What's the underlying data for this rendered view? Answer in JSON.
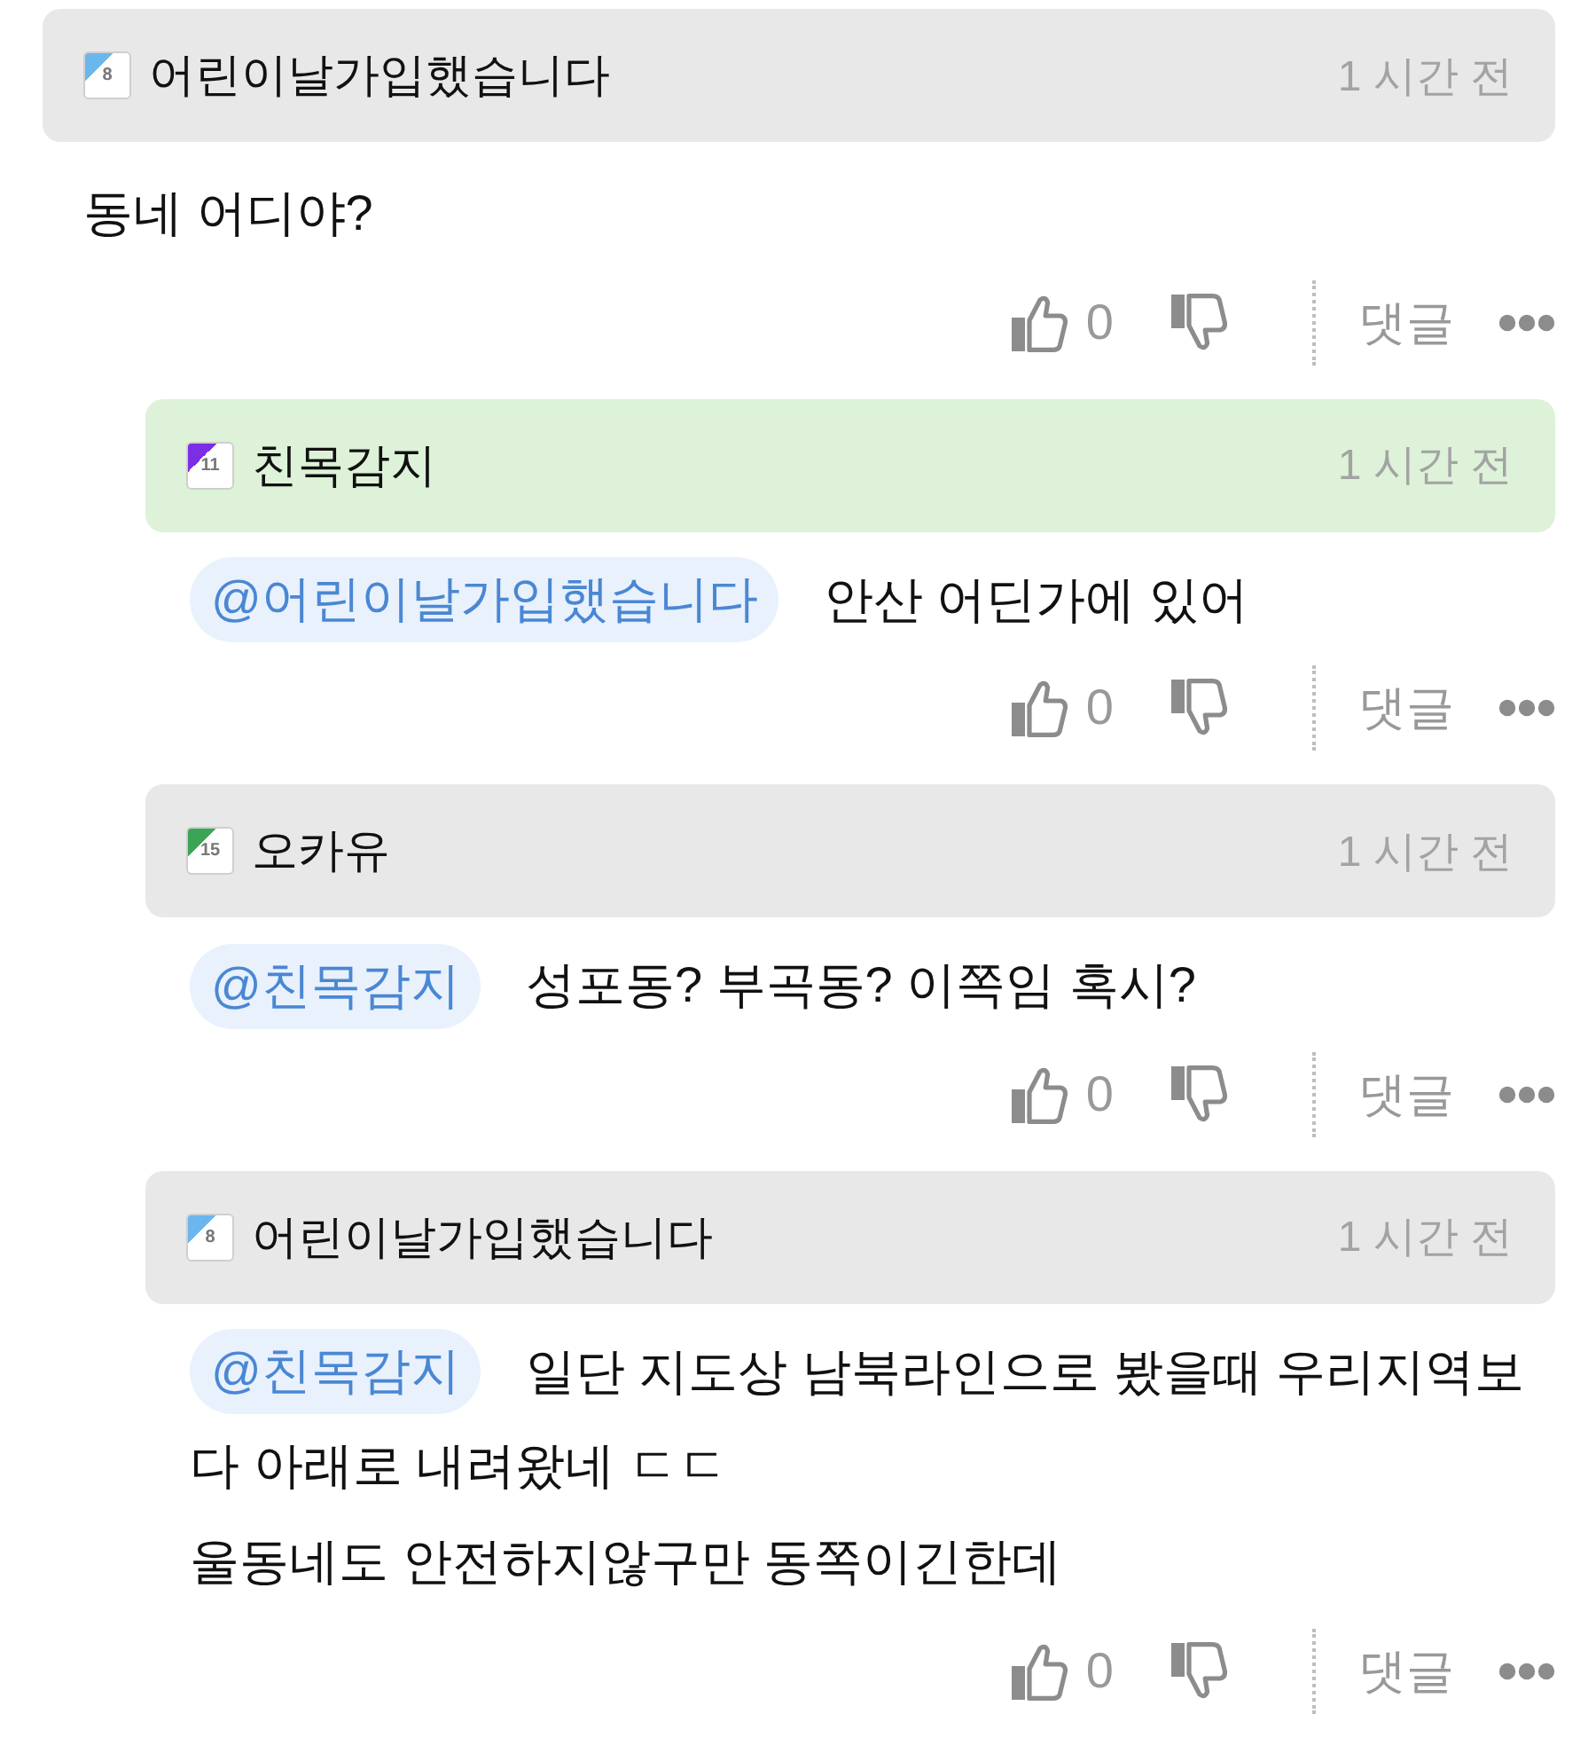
{
  "comments": [
    {
      "author": "어린이날가입했습니다",
      "badge": {
        "text": "8",
        "color": "#6cb6ee"
      },
      "highlighted": false,
      "time": "1 시간 전",
      "text": "동네 어디야?",
      "likes": "0",
      "reply_label": "댓글",
      "children": [
        {
          "author": "친목감지",
          "badge": {
            "text": "11",
            "color": "#7a2ee6"
          },
          "highlighted": true,
          "time": "1 시간 전",
          "mention": "@어린이날가입했습니다",
          "text": "안산 어딘가에 있어",
          "likes": "0",
          "reply_label": "댓글"
        },
        {
          "author": "오카유",
          "badge": {
            "text": "15",
            "color": "#3aa655"
          },
          "highlighted": false,
          "time": "1 시간 전",
          "mention": "@친목감지",
          "text": "성포동? 부곡동? 이쪽임 혹시?",
          "likes": "0",
          "reply_label": "댓글"
        },
        {
          "author": "어린이날가입했습니다",
          "badge": {
            "text": "8",
            "color": "#6cb6ee"
          },
          "highlighted": false,
          "time": "1 시간 전",
          "mention": "@친목감지",
          "text": "일단 지도상 남북라인으로 봤을때 우리지역보\n다 아래로 내려왔네 ㄷㄷ\n울동네도 안전하지않구만 동쪽이긴한데",
          "likes": "0",
          "reply_label": "댓글"
        }
      ]
    }
  ]
}
